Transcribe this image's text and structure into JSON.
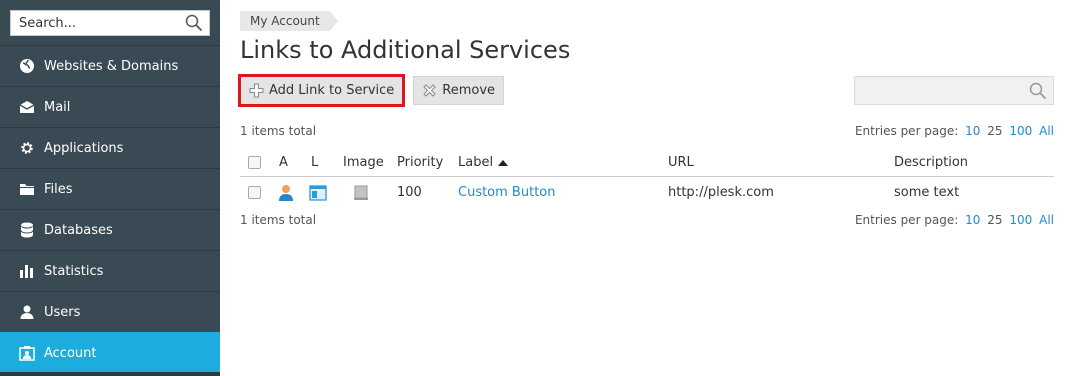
{
  "sidebar": {
    "search_placeholder": "Search...",
    "items": [
      {
        "label": "Websites & Domains",
        "icon": "globe-icon"
      },
      {
        "label": "Mail",
        "icon": "envelope-icon"
      },
      {
        "label": "Applications",
        "icon": "gear-icon"
      },
      {
        "label": "Files",
        "icon": "folder-icon"
      },
      {
        "label": "Databases",
        "icon": "database-icon"
      },
      {
        "label": "Statistics",
        "icon": "bar-chart-icon"
      },
      {
        "label": "Users",
        "icon": "user-icon"
      },
      {
        "label": "Account",
        "icon": "account-icon",
        "active": true
      }
    ]
  },
  "breadcrumb": {
    "item": "My Account"
  },
  "page": {
    "title": "Links to Additional Services"
  },
  "toolbar": {
    "add_label": "Add Link to Service",
    "remove_label": "Remove"
  },
  "list": {
    "total_top": "1 items total",
    "total_bottom": "1 items total",
    "per_page_label": "Entries per page:",
    "per_page_options": [
      "10",
      "25",
      "100",
      "All"
    ],
    "per_page_current": "25"
  },
  "table": {
    "headers": {
      "a": "A",
      "l": "L",
      "image": "Image",
      "priority": "Priority",
      "label": "Label",
      "url": "URL",
      "description": "Description"
    },
    "rows": [
      {
        "priority": "100",
        "label": "Custom Button",
        "url": "http://plesk.com",
        "description": "some text"
      }
    ]
  },
  "colors": {
    "sidebar_bg": "#3a4a55",
    "active": "#1dacde",
    "link": "#1f8bd0",
    "highlight": "#e0151d"
  }
}
